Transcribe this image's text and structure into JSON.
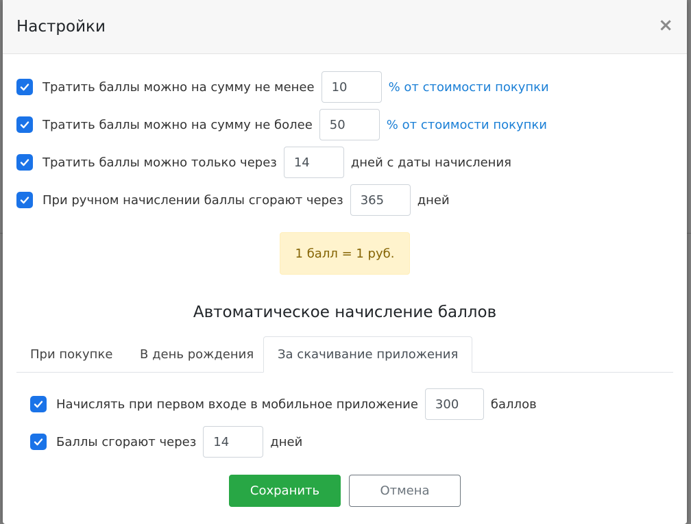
{
  "dialog": {
    "title": "Настройки",
    "close_glyph": "×"
  },
  "settings": [
    {
      "checked": true,
      "label": "Тратить баллы можно на сумму не менее",
      "value": "10",
      "suffix": "% от стоимости покупки"
    },
    {
      "checked": true,
      "label": "Тратить баллы можно на сумму не более",
      "value": "50",
      "suffix": "% от стоимости покупки"
    },
    {
      "checked": true,
      "label": "Тратить баллы можно только через",
      "value": "14",
      "suffix": "дней с даты начисления"
    },
    {
      "checked": true,
      "label": "При ручном начислении баллы сгорают через",
      "value": "365",
      "suffix": "дней"
    }
  ],
  "rate_notice": "1 балл = 1 руб.",
  "auto_section": {
    "title": "Автоматическое начисление баллов",
    "tabs": [
      {
        "label": "При покупке",
        "active": false
      },
      {
        "label": "В день рождения",
        "active": false
      },
      {
        "label": "За скачивание приложения",
        "active": true
      }
    ],
    "app_settings": [
      {
        "checked": true,
        "label": "Начислять при первом входе в мобильное приложение",
        "value": "300",
        "suffix": "баллов"
      },
      {
        "checked": true,
        "label": "Баллы сгорают через",
        "value": "14",
        "suffix": "дней"
      }
    ]
  },
  "buttons": {
    "save": "Сохранить",
    "cancel": "Отмена"
  },
  "colors": {
    "accent": "#1a73e8",
    "link": "#1a7fd6",
    "success": "#28a745",
    "notice_bg": "#fff3cd",
    "notice_text": "#856404"
  }
}
